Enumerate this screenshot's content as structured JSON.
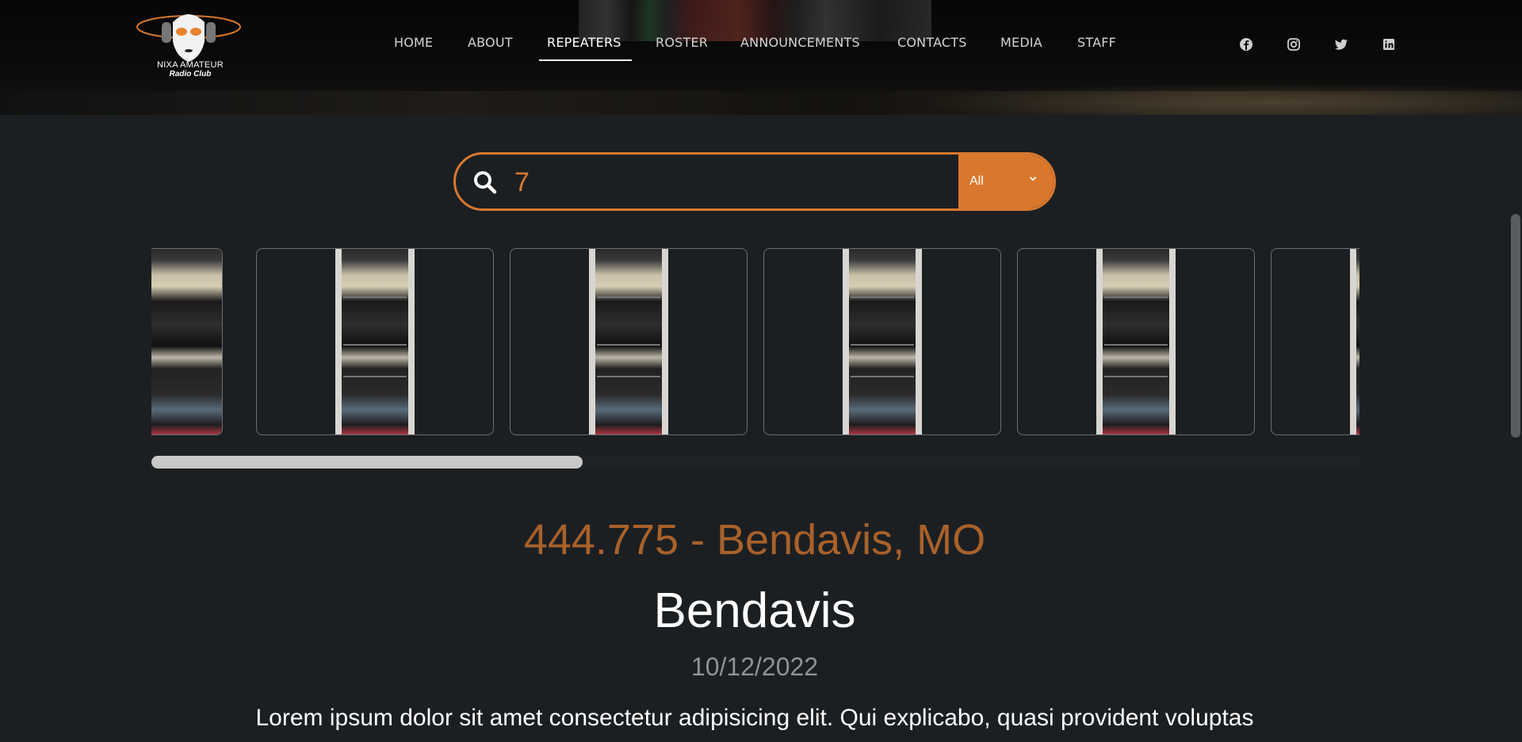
{
  "header": {
    "logo": {
      "line1": "NIXA AMATEUR",
      "line2": "Radio Club"
    },
    "nav": [
      {
        "label": "HOME",
        "name": "nav-home"
      },
      {
        "label": "ABOUT",
        "name": "nav-about"
      },
      {
        "label": "REPEATERS",
        "name": "nav-repeaters",
        "active": true
      },
      {
        "label": "ROSTER",
        "name": "nav-roster"
      },
      {
        "label": "ANNOUNCEMENTS",
        "name": "nav-announcements"
      },
      {
        "label": "CONTACTS",
        "name": "nav-contacts"
      },
      {
        "label": "MEDIA",
        "name": "nav-media"
      },
      {
        "label": "STAFF",
        "name": "nav-staff"
      }
    ],
    "social": [
      "facebook-icon",
      "instagram-icon",
      "twitter-icon",
      "linkedin-icon"
    ]
  },
  "search": {
    "value": "7",
    "filter_selected": "All",
    "icon": "search-icon"
  },
  "gallery": {
    "visible_cards": 6,
    "scroll_fraction": 0.36
  },
  "repeater": {
    "frequency_location": "444.775 - Bendavis, MO",
    "name": "Bendavis",
    "date": "10/12/2022",
    "description": "Lorem ipsum dolor sit amet consectetur adipisicing elit. Qui explicabo, quasi provident voluptas"
  },
  "colors": {
    "accent": "#d9782d",
    "heading_accent": "#a8612b",
    "background": "#1c1f22"
  }
}
